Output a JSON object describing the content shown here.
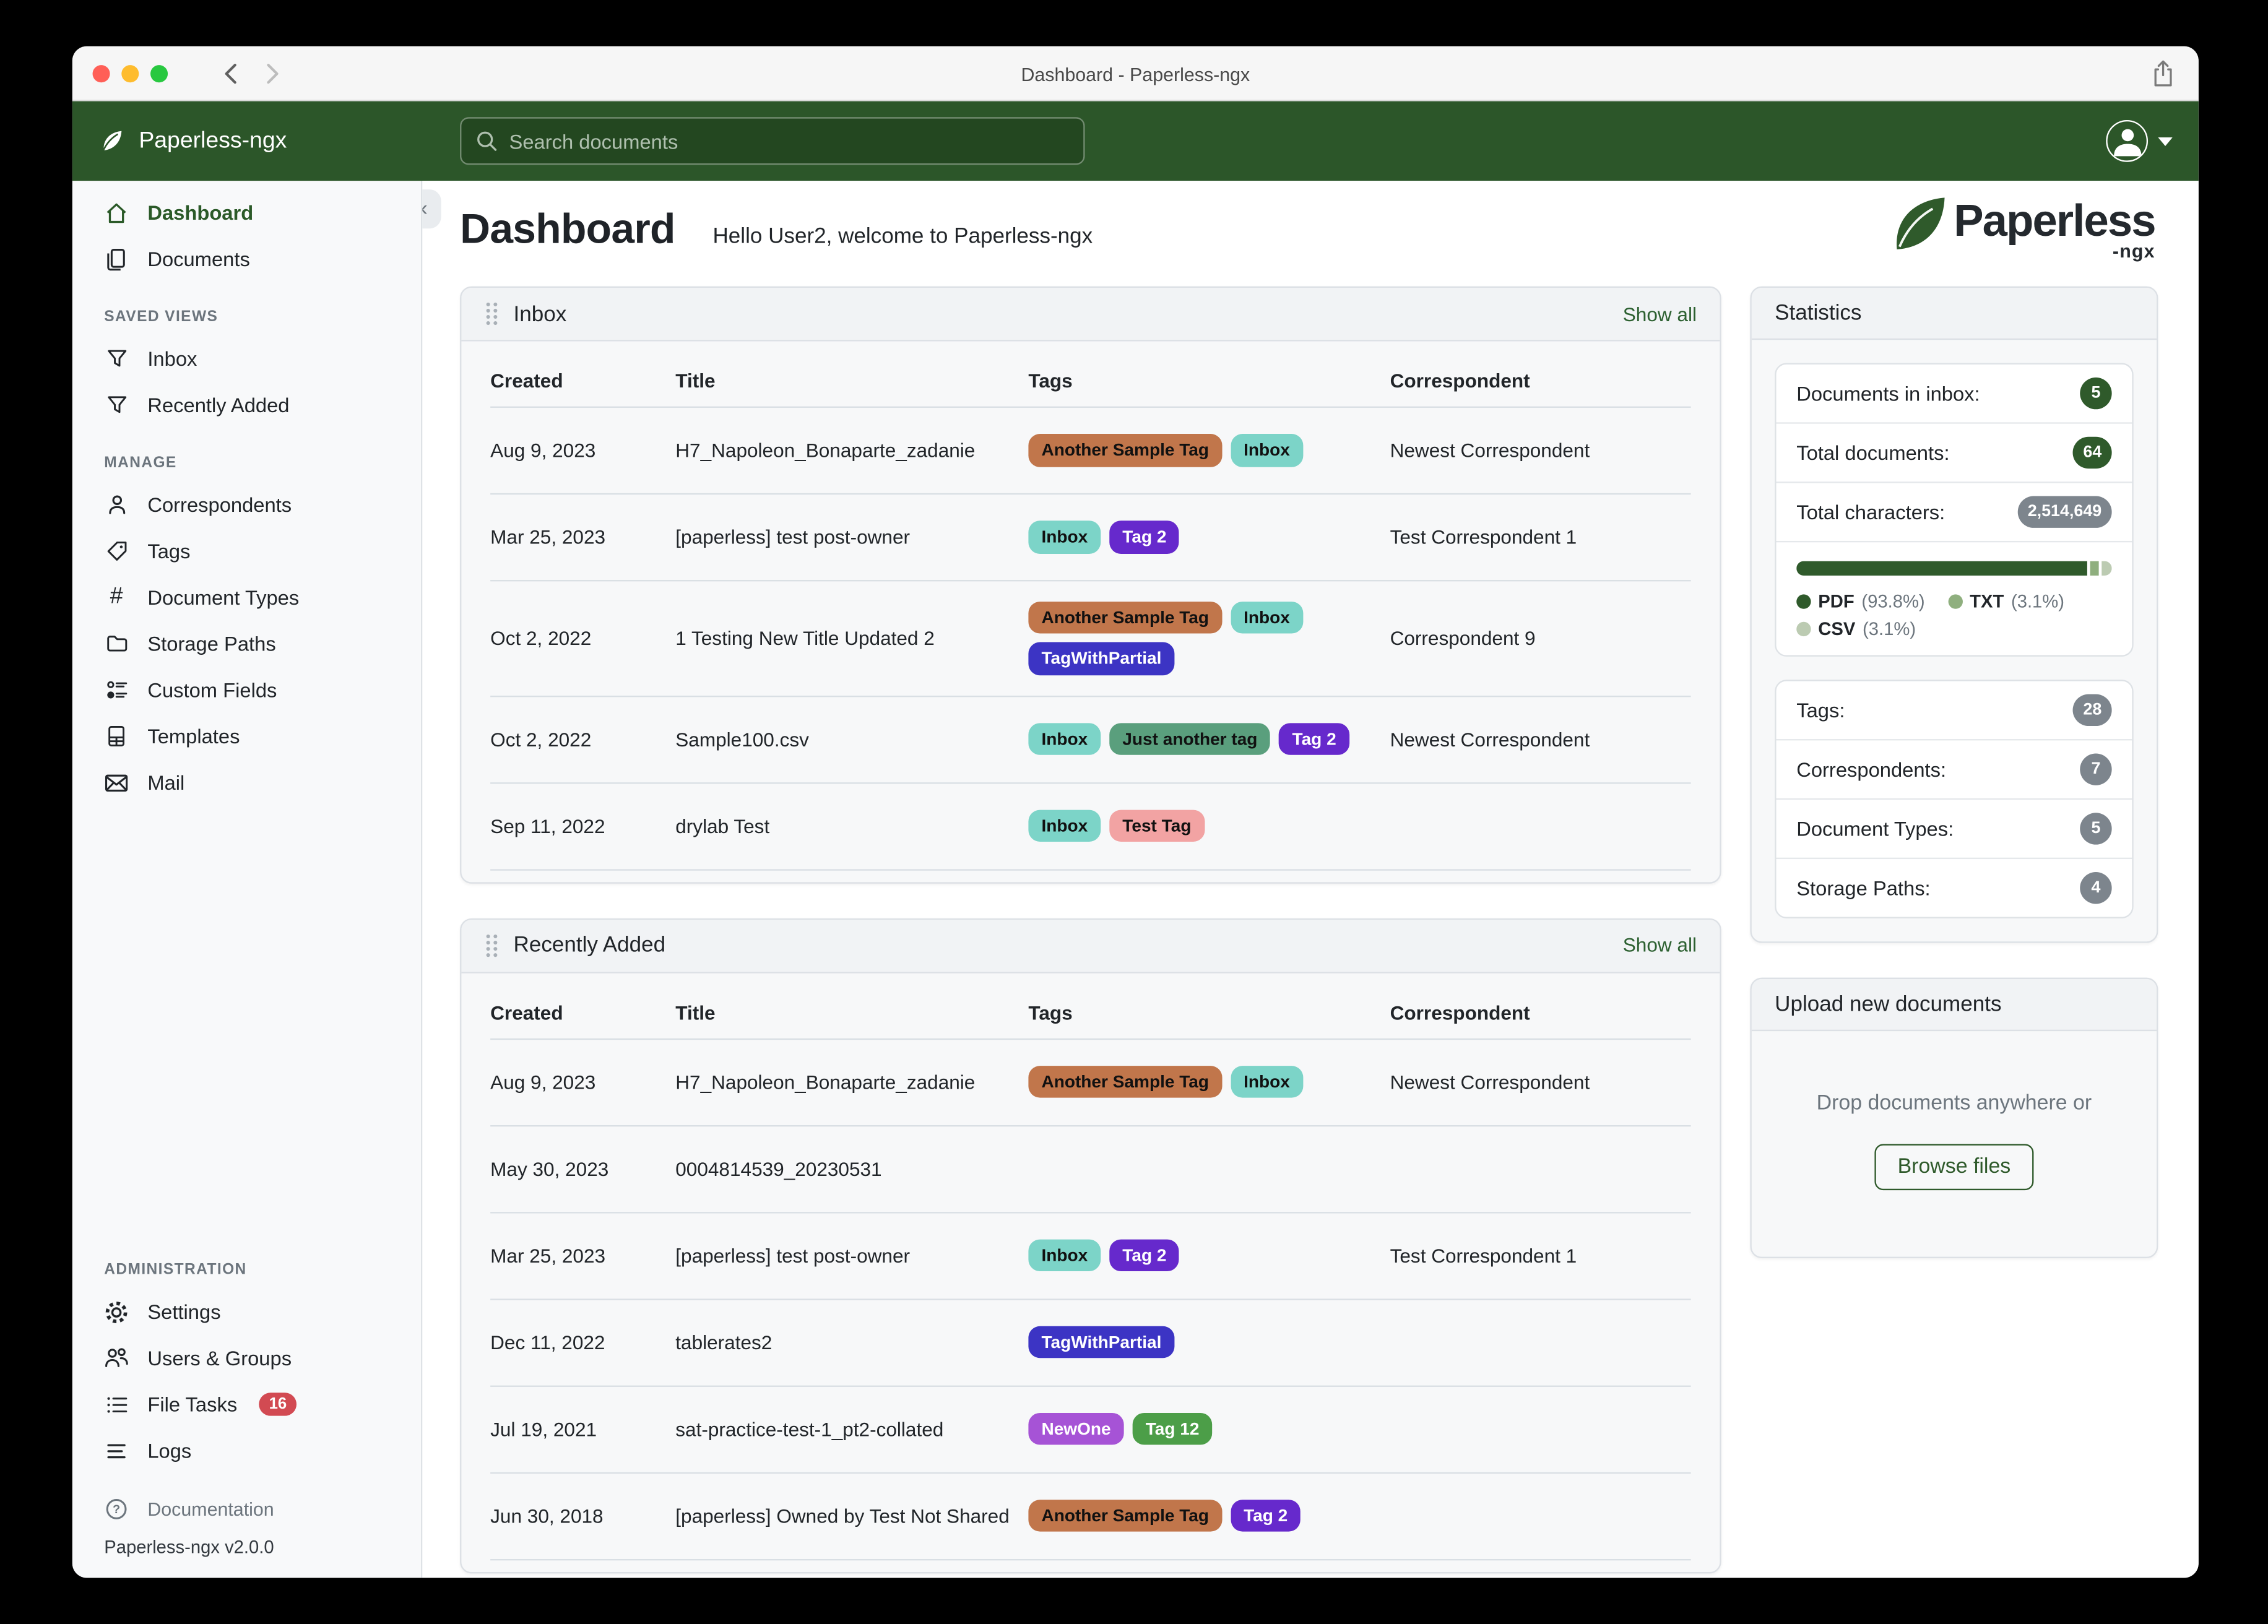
{
  "colors": {
    "header_green": "#2C5629",
    "link_green": "#2C6030",
    "active_green": "#2B5A28",
    "badge_green": "#2F5A2B",
    "badge_gray": "#7D858D",
    "danger_red": "#D24A52"
  },
  "window_title": "Dashboard - Paperless-ngx",
  "header": {
    "brand": "Paperless-ngx",
    "search_placeholder": "Search documents"
  },
  "sidebar": {
    "dashboard": "Dashboard",
    "documents": "Documents",
    "saved_views_label": "SAVED VIEWS",
    "inbox": "Inbox",
    "recently_added": "Recently Added",
    "manage_label": "MANAGE",
    "correspondents": "Correspondents",
    "tags": "Tags",
    "document_types": "Document Types",
    "storage_paths": "Storage Paths",
    "custom_fields": "Custom Fields",
    "templates": "Templates",
    "mail": "Mail",
    "administration_label": "ADMINISTRATION",
    "settings": "Settings",
    "users_groups": "Users & Groups",
    "file_tasks": "File Tasks",
    "file_tasks_badge": "16",
    "logs": "Logs",
    "documentation": "Documentation",
    "version": "Paperless-ngx v2.0.0"
  },
  "page": {
    "title": "Dashboard",
    "greeting": "Hello User2, welcome to Paperless-ngx"
  },
  "logo": {
    "name": "Paperless",
    "suffix": "-ngx"
  },
  "columns": [
    "Created",
    "Title",
    "Tags",
    "Correspondent"
  ],
  "show_all": "Show all",
  "inbox_card": {
    "title": "Inbox",
    "rows": [
      {
        "created": "Aug 9, 2023",
        "title": "H7_Napoleon_Bonaparte_zadanie",
        "tags": [
          {
            "label": "Another Sample Tag",
            "bg": "#C1764B",
            "fg": "#111111"
          },
          {
            "label": "Inbox",
            "bg": "#7CD4C8",
            "fg": "#111111"
          }
        ],
        "correspondent": "Newest Correspondent"
      },
      {
        "created": "Mar 25, 2023",
        "title": "[paperless] test post-owner",
        "tags": [
          {
            "label": "Inbox",
            "bg": "#7CD4C8",
            "fg": "#111111"
          },
          {
            "label": "Tag 2",
            "bg": "#6629CC",
            "fg": "#FFFFFF"
          }
        ],
        "correspondent": "Test Correspondent 1"
      },
      {
        "created": "Oct 2, 2022",
        "title": "1 Testing New Title Updated 2",
        "tags": [
          {
            "label": "Another Sample Tag",
            "bg": "#C1764B",
            "fg": "#111111"
          },
          {
            "label": "Inbox",
            "bg": "#7CD4C8",
            "fg": "#111111"
          },
          {
            "label": "TagWithPartial",
            "bg": "#3C34C4",
            "fg": "#FFFFFF"
          }
        ],
        "correspondent": "Correspondent 9"
      },
      {
        "created": "Oct 2, 2022",
        "title": "Sample100.csv",
        "tags": [
          {
            "label": "Inbox",
            "bg": "#7CD4C8",
            "fg": "#111111"
          },
          {
            "label": "Just another tag",
            "bg": "#5A9F7D",
            "fg": "#111111"
          },
          {
            "label": "Tag 2",
            "bg": "#6629CC",
            "fg": "#FFFFFF"
          }
        ],
        "correspondent": "Newest Correspondent"
      },
      {
        "created": "Sep 11, 2022",
        "title": "drylab Test",
        "tags": [
          {
            "label": "Inbox",
            "bg": "#7CD4C8",
            "fg": "#111111"
          },
          {
            "label": "Test Tag",
            "bg": "#F2A3A3",
            "fg": "#111111"
          }
        ],
        "correspondent": ""
      }
    ]
  },
  "recent_card": {
    "title": "Recently Added",
    "rows": [
      {
        "created": "Aug 9, 2023",
        "title": "H7_Napoleon_Bonaparte_zadanie",
        "tags": [
          {
            "label": "Another Sample Tag",
            "bg": "#C1764B",
            "fg": "#111111"
          },
          {
            "label": "Inbox",
            "bg": "#7CD4C8",
            "fg": "#111111"
          }
        ],
        "correspondent": "Newest Correspondent"
      },
      {
        "created": "May 30, 2023",
        "title": "0004814539_20230531",
        "tags": [],
        "correspondent": ""
      },
      {
        "created": "Mar 25, 2023",
        "title": "[paperless] test post-owner",
        "tags": [
          {
            "label": "Inbox",
            "bg": "#7CD4C8",
            "fg": "#111111"
          },
          {
            "label": "Tag 2",
            "bg": "#6629CC",
            "fg": "#FFFFFF"
          }
        ],
        "correspondent": "Test Correspondent 1"
      },
      {
        "created": "Dec 11, 2022",
        "title": "tablerates2",
        "tags": [
          {
            "label": "TagWithPartial",
            "bg": "#3C34C4",
            "fg": "#FFFFFF"
          }
        ],
        "correspondent": ""
      },
      {
        "created": "Jul 19, 2021",
        "title": "sat-practice-test-1_pt2-collated",
        "tags": [
          {
            "label": "NewOne",
            "bg": "#A653D6",
            "fg": "#FFFFFF"
          },
          {
            "label": "Tag 12",
            "bg": "#4C9E48",
            "fg": "#FFFFFF"
          }
        ],
        "correspondent": ""
      },
      {
        "created": "Jun 30, 2018",
        "title": "[paperless] Owned by Test Not Shared",
        "tags": [
          {
            "label": "Another Sample Tag",
            "bg": "#C1764B",
            "fg": "#111111"
          },
          {
            "label": "Tag 2",
            "bg": "#6629CC",
            "fg": "#FFFFFF"
          }
        ],
        "correspondent": ""
      }
    ]
  },
  "statistics": {
    "title": "Statistics",
    "docs_in_inbox_label": "Documents in inbox:",
    "docs_in_inbox_value": "5",
    "total_documents_label": "Total documents:",
    "total_documents_value": "64",
    "total_characters_label": "Total characters:",
    "total_characters_value": "2,514,649",
    "types": [
      {
        "name": "PDF",
        "pct_text": "(93.8%)",
        "width": "93.8%",
        "color": "#2F5A2B"
      },
      {
        "name": "TXT",
        "pct_text": "(3.1%)",
        "width": "3.1%",
        "color": "#8FAF7E"
      },
      {
        "name": "CSV",
        "pct_text": "(3.1%)",
        "width": "3.1%",
        "color": "#BCCBB2"
      }
    ],
    "tags_label": "Tags:",
    "tags_value": "28",
    "correspondents_label": "Correspondents:",
    "correspondents_value": "7",
    "document_types_label": "Document Types:",
    "document_types_value": "5",
    "storage_paths_label": "Storage Paths:",
    "storage_paths_value": "4"
  },
  "upload": {
    "title": "Upload new documents",
    "hint": "Drop documents anywhere or",
    "button": "Browse files"
  }
}
